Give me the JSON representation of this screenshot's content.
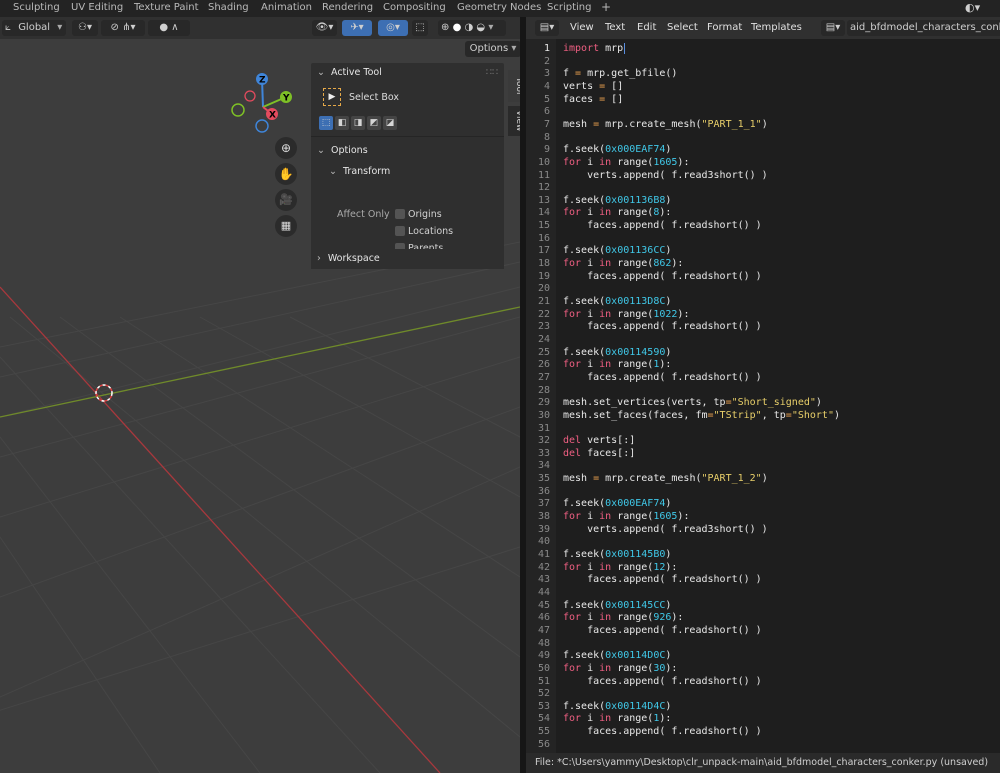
{
  "workspace_tabs": [
    "Sculpting",
    "UV Editing",
    "Texture Paint",
    "Shading",
    "Animation",
    "Rendering",
    "Compositing",
    "Geometry Nodes",
    "Scripting",
    "+"
  ],
  "viewport": {
    "orientation": "Global",
    "options_label": "Options",
    "n_panel": {
      "active_tool": "Active Tool",
      "tool_name": "Select Box",
      "options": "Options",
      "transform": "Transform",
      "affect_only": "Affect Only",
      "checkboxes": [
        "Origins",
        "Locations",
        "Parents"
      ],
      "workspace": "Workspace"
    },
    "side_tabs": [
      "Tool",
      "View"
    ],
    "gizmo_axes": [
      "Z",
      "Y",
      "X"
    ]
  },
  "editor": {
    "menu": [
      "View",
      "Text",
      "Edit",
      "Select",
      "Format",
      "Templates"
    ],
    "filename": "aid_bfdmodel_characters_conker.py",
    "lines": [
      [
        {
          "t": "kw",
          "v": "import"
        },
        {
          "t": "",
          "v": " mrp"
        }
      ],
      [],
      [
        {
          "t": "",
          "v": "f "
        },
        {
          "t": "op",
          "v": "="
        },
        {
          "t": "",
          "v": " mrp.get_bfile()"
        }
      ],
      [
        {
          "t": "",
          "v": "verts "
        },
        {
          "t": "op",
          "v": "="
        },
        {
          "t": "",
          "v": " []"
        }
      ],
      [
        {
          "t": "",
          "v": "faces "
        },
        {
          "t": "op",
          "v": "="
        },
        {
          "t": "",
          "v": " []"
        }
      ],
      [],
      [
        {
          "t": "",
          "v": "mesh "
        },
        {
          "t": "op",
          "v": "="
        },
        {
          "t": "",
          "v": " mrp.create_mesh("
        },
        {
          "t": "str",
          "v": "\"PART_1_1\""
        },
        {
          "t": "",
          "v": ")"
        }
      ],
      [],
      [
        {
          "t": "",
          "v": "f.seek("
        },
        {
          "t": "num",
          "v": "0x000EAF74"
        },
        {
          "t": "",
          "v": ")"
        }
      ],
      [
        {
          "t": "kw",
          "v": "for"
        },
        {
          "t": "",
          "v": " i "
        },
        {
          "t": "kw",
          "v": "in"
        },
        {
          "t": "",
          "v": " range("
        },
        {
          "t": "num",
          "v": "1605"
        },
        {
          "t": "",
          "v": "):"
        }
      ],
      [
        {
          "t": "",
          "v": "    verts.append( f.read3short() )"
        }
      ],
      [],
      [
        {
          "t": "",
          "v": "f.seek("
        },
        {
          "t": "num",
          "v": "0x001136B8"
        },
        {
          "t": "",
          "v": ")"
        }
      ],
      [
        {
          "t": "kw",
          "v": "for"
        },
        {
          "t": "",
          "v": " i "
        },
        {
          "t": "kw",
          "v": "in"
        },
        {
          "t": "",
          "v": " range("
        },
        {
          "t": "num",
          "v": "8"
        },
        {
          "t": "",
          "v": "):"
        }
      ],
      [
        {
          "t": "",
          "v": "    faces.append( f.readshort() )"
        }
      ],
      [],
      [
        {
          "t": "",
          "v": "f.seek("
        },
        {
          "t": "num",
          "v": "0x001136CC"
        },
        {
          "t": "",
          "v": ")"
        }
      ],
      [
        {
          "t": "kw",
          "v": "for"
        },
        {
          "t": "",
          "v": " i "
        },
        {
          "t": "kw",
          "v": "in"
        },
        {
          "t": "",
          "v": " range("
        },
        {
          "t": "num",
          "v": "862"
        },
        {
          "t": "",
          "v": "):"
        }
      ],
      [
        {
          "t": "",
          "v": "    faces.append( f.readshort() )"
        }
      ],
      [],
      [
        {
          "t": "",
          "v": "f.seek("
        },
        {
          "t": "num",
          "v": "0x00113D8C"
        },
        {
          "t": "",
          "v": ")"
        }
      ],
      [
        {
          "t": "kw",
          "v": "for"
        },
        {
          "t": "",
          "v": " i "
        },
        {
          "t": "kw",
          "v": "in"
        },
        {
          "t": "",
          "v": " range("
        },
        {
          "t": "num",
          "v": "1022"
        },
        {
          "t": "",
          "v": "):"
        }
      ],
      [
        {
          "t": "",
          "v": "    faces.append( f.readshort() )"
        }
      ],
      [],
      [
        {
          "t": "",
          "v": "f.seek("
        },
        {
          "t": "num",
          "v": "0x00114590"
        },
        {
          "t": "",
          "v": ")"
        }
      ],
      [
        {
          "t": "kw",
          "v": "for"
        },
        {
          "t": "",
          "v": " i "
        },
        {
          "t": "kw",
          "v": "in"
        },
        {
          "t": "",
          "v": " range("
        },
        {
          "t": "num",
          "v": "1"
        },
        {
          "t": "",
          "v": "):"
        }
      ],
      [
        {
          "t": "",
          "v": "    faces.append( f.readshort() )"
        }
      ],
      [],
      [
        {
          "t": "",
          "v": "mesh.set_vertices(verts, tp"
        },
        {
          "t": "op",
          "v": "="
        },
        {
          "t": "str",
          "v": "\"Short_signed\""
        },
        {
          "t": "",
          "v": ")"
        }
      ],
      [
        {
          "t": "",
          "v": "mesh.set_faces(faces, fm"
        },
        {
          "t": "op",
          "v": "="
        },
        {
          "t": "str",
          "v": "\"TStrip\""
        },
        {
          "t": "",
          "v": ", tp"
        },
        {
          "t": "op",
          "v": "="
        },
        {
          "t": "str",
          "v": "\"Short\""
        },
        {
          "t": "",
          "v": ")"
        }
      ],
      [],
      [
        {
          "t": "kw",
          "v": "del"
        },
        {
          "t": "",
          "v": " verts[:]"
        }
      ],
      [
        {
          "t": "kw",
          "v": "del"
        },
        {
          "t": "",
          "v": " faces[:]"
        }
      ],
      [],
      [
        {
          "t": "",
          "v": "mesh "
        },
        {
          "t": "op",
          "v": "="
        },
        {
          "t": "",
          "v": " mrp.create_mesh("
        },
        {
          "t": "str",
          "v": "\"PART_1_2\""
        },
        {
          "t": "",
          "v": ")"
        }
      ],
      [],
      [
        {
          "t": "",
          "v": "f.seek("
        },
        {
          "t": "num",
          "v": "0x000EAF74"
        },
        {
          "t": "",
          "v": ")"
        }
      ],
      [
        {
          "t": "kw",
          "v": "for"
        },
        {
          "t": "",
          "v": " i "
        },
        {
          "t": "kw",
          "v": "in"
        },
        {
          "t": "",
          "v": " range("
        },
        {
          "t": "num",
          "v": "1605"
        },
        {
          "t": "",
          "v": "):"
        }
      ],
      [
        {
          "t": "",
          "v": "    verts.append( f.read3short() )"
        }
      ],
      [],
      [
        {
          "t": "",
          "v": "f.seek("
        },
        {
          "t": "num",
          "v": "0x001145B0"
        },
        {
          "t": "",
          "v": ")"
        }
      ],
      [
        {
          "t": "kw",
          "v": "for"
        },
        {
          "t": "",
          "v": " i "
        },
        {
          "t": "kw",
          "v": "in"
        },
        {
          "t": "",
          "v": " range("
        },
        {
          "t": "num",
          "v": "12"
        },
        {
          "t": "",
          "v": "):"
        }
      ],
      [
        {
          "t": "",
          "v": "    faces.append( f.readshort() )"
        }
      ],
      [],
      [
        {
          "t": "",
          "v": "f.seek("
        },
        {
          "t": "num",
          "v": "0x001145CC"
        },
        {
          "t": "",
          "v": ")"
        }
      ],
      [
        {
          "t": "kw",
          "v": "for"
        },
        {
          "t": "",
          "v": " i "
        },
        {
          "t": "kw",
          "v": "in"
        },
        {
          "t": "",
          "v": " range("
        },
        {
          "t": "num",
          "v": "926"
        },
        {
          "t": "",
          "v": "):"
        }
      ],
      [
        {
          "t": "",
          "v": "    faces.append( f.readshort() )"
        }
      ],
      [],
      [
        {
          "t": "",
          "v": "f.seek("
        },
        {
          "t": "num",
          "v": "0x00114D0C"
        },
        {
          "t": "",
          "v": ")"
        }
      ],
      [
        {
          "t": "kw",
          "v": "for"
        },
        {
          "t": "",
          "v": " i "
        },
        {
          "t": "kw",
          "v": "in"
        },
        {
          "t": "",
          "v": " range("
        },
        {
          "t": "num",
          "v": "30"
        },
        {
          "t": "",
          "v": "):"
        }
      ],
      [
        {
          "t": "",
          "v": "    faces.append( f.readshort() )"
        }
      ],
      [],
      [
        {
          "t": "",
          "v": "f.seek("
        },
        {
          "t": "num",
          "v": "0x00114D4C"
        },
        {
          "t": "",
          "v": ")"
        }
      ],
      [
        {
          "t": "kw",
          "v": "for"
        },
        {
          "t": "",
          "v": " i "
        },
        {
          "t": "kw",
          "v": "in"
        },
        {
          "t": "",
          "v": " range("
        },
        {
          "t": "num",
          "v": "1"
        },
        {
          "t": "",
          "v": "):"
        }
      ],
      [
        {
          "t": "",
          "v": "    faces.append( f.readshort() )"
        }
      ],
      []
    ]
  },
  "status": "File: *C:\\Users\\yammy\\Desktop\\clr_unpack-main\\aid_bfdmodel_characters_conker.py (unsaved)"
}
